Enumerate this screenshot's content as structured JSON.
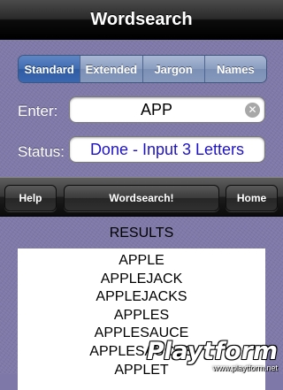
{
  "header": {
    "title": "Wordsearch"
  },
  "segments": [
    {
      "label": "Standard",
      "selected": true
    },
    {
      "label": "Extended",
      "selected": false
    },
    {
      "label": "Jargon",
      "selected": false
    },
    {
      "label": "Names",
      "selected": false
    }
  ],
  "enter": {
    "label": "Enter:",
    "value": "APP",
    "clear_icon": "clear-circle-icon"
  },
  "status": {
    "label": "Status:",
    "value": "Done - Input 3 Letters"
  },
  "toolbar": {
    "help_label": "Help",
    "wordsearch_label": "Wordsearch!",
    "home_label": "Home"
  },
  "results": {
    "heading": "RESULTS",
    "items": [
      "APPLE",
      "APPLEJACK",
      "APPLEJACKS",
      "APPLES",
      "APPLESAUCE",
      "APPLESAUCES",
      "APPLET"
    ]
  },
  "watermark": {
    "logo_text": "Playtform",
    "url": "www.playtform.net"
  },
  "colors": {
    "status_text": "#1e13c9",
    "segment_selected": "#3f6bb2",
    "background": "#7f79a9"
  }
}
